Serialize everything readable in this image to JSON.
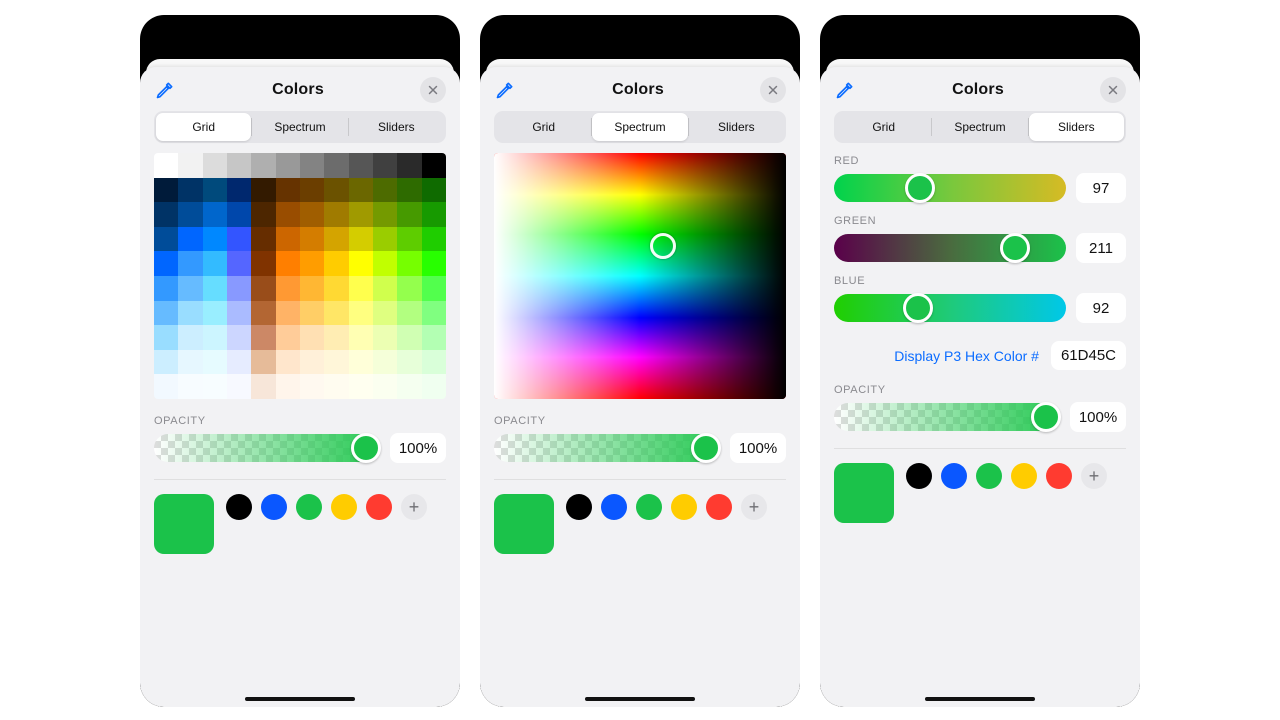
{
  "title": "Colors",
  "tabs": {
    "grid": "Grid",
    "spectrum": "Spectrum",
    "sliders": "Sliders"
  },
  "opacity_label": "OPACITY",
  "opacity_value": "100%",
  "current_color": "#1bc24a",
  "swatches": {
    "black": "#000000",
    "blue": "#0a57ff",
    "green": "#1bc24a",
    "yellow": "#ffcc00",
    "red": "#ff3b30"
  },
  "grid_rows": [
    [
      "#ffffff",
      "#f2f2f2",
      "#dcdcdc",
      "#c6c6c6",
      "#afafaf",
      "#999999",
      "#838383",
      "#6c6c6c",
      "#565656",
      "#404040",
      "#2a2a2a",
      "#000000"
    ],
    [
      "#001b3a",
      "#003366",
      "#004a7c",
      "#00286e",
      "#331a00",
      "#663300",
      "#6b3e00",
      "#6b5200",
      "#6b6700",
      "#4d6b00",
      "#2e6b00",
      "#0f6b00"
    ],
    [
      "#003366",
      "#004c99",
      "#0066cc",
      "#0047ab",
      "#4d2600",
      "#994d00",
      "#a05e00",
      "#a07b00",
      "#a09a00",
      "#749a00",
      "#469a00",
      "#179a00"
    ],
    [
      "#004c99",
      "#0066ff",
      "#0088ff",
      "#3355ff",
      "#662d00",
      "#cc6600",
      "#d47d00",
      "#d4a400",
      "#d4cd00",
      "#9acd00",
      "#5ecd00",
      "#1fcd00"
    ],
    [
      "#0066ff",
      "#3399ff",
      "#33bbff",
      "#5566ff",
      "#803300",
      "#ff7f00",
      "#ff9d00",
      "#ffcc00",
      "#ffff00",
      "#c1ff00",
      "#76ff00",
      "#28ff00"
    ],
    [
      "#3399ff",
      "#66bbff",
      "#66ddff",
      "#8899ff",
      "#994d1a",
      "#ff9933",
      "#ffb733",
      "#ffd933",
      "#ffff4d",
      "#d0ff4d",
      "#94ff4d",
      "#52ff4d"
    ],
    [
      "#66bbff",
      "#99ddff",
      "#99eeff",
      "#aabbff",
      "#b36633",
      "#ffb366",
      "#ffce66",
      "#ffe666",
      "#ffff80",
      "#dfff80",
      "#b2ff80",
      "#80ff80"
    ],
    [
      "#99ddff",
      "#cceeff",
      "#ccf5ff",
      "#ccd6ff",
      "#cc8866",
      "#ffcc99",
      "#ffe0b3",
      "#ffedb3",
      "#ffffb3",
      "#ecffb3",
      "#d0ffb3",
      "#b3ffb3"
    ],
    [
      "#cceeff",
      "#e6f7ff",
      "#e6fbff",
      "#e6ecff",
      "#e6bb99",
      "#ffe6cc",
      "#fff0d9",
      "#fff6d9",
      "#ffffd9",
      "#f5ffd9",
      "#e7ffd9",
      "#d9ffd9"
    ],
    [
      "#f2f9ff",
      "#f7fcff",
      "#f7fdff",
      "#f7f9ff",
      "#f7e6d9",
      "#fff5eb",
      "#fff9f0",
      "#fffcf0",
      "#fffff0",
      "#fbfff0",
      "#f5fff0",
      "#f0fff0"
    ]
  ],
  "sliders": {
    "red": {
      "label": "RED",
      "value": "97",
      "pos": 37,
      "grad": [
        "#00d34c",
        "#78c83d",
        "#d6bb24"
      ]
    },
    "green": {
      "label": "GREEN",
      "value": "211",
      "pos": 78,
      "grad": [
        "#5a004a",
        "#4a6a3f",
        "#1bc24a"
      ]
    },
    "blue": {
      "label": "BLUE",
      "value": "92",
      "pos": 36,
      "grad": [
        "#20cf00",
        "#1fca7a",
        "#00c8e8"
      ]
    },
    "hex_label": "Display P3 Hex Color #",
    "hex_value": "61D45C"
  }
}
